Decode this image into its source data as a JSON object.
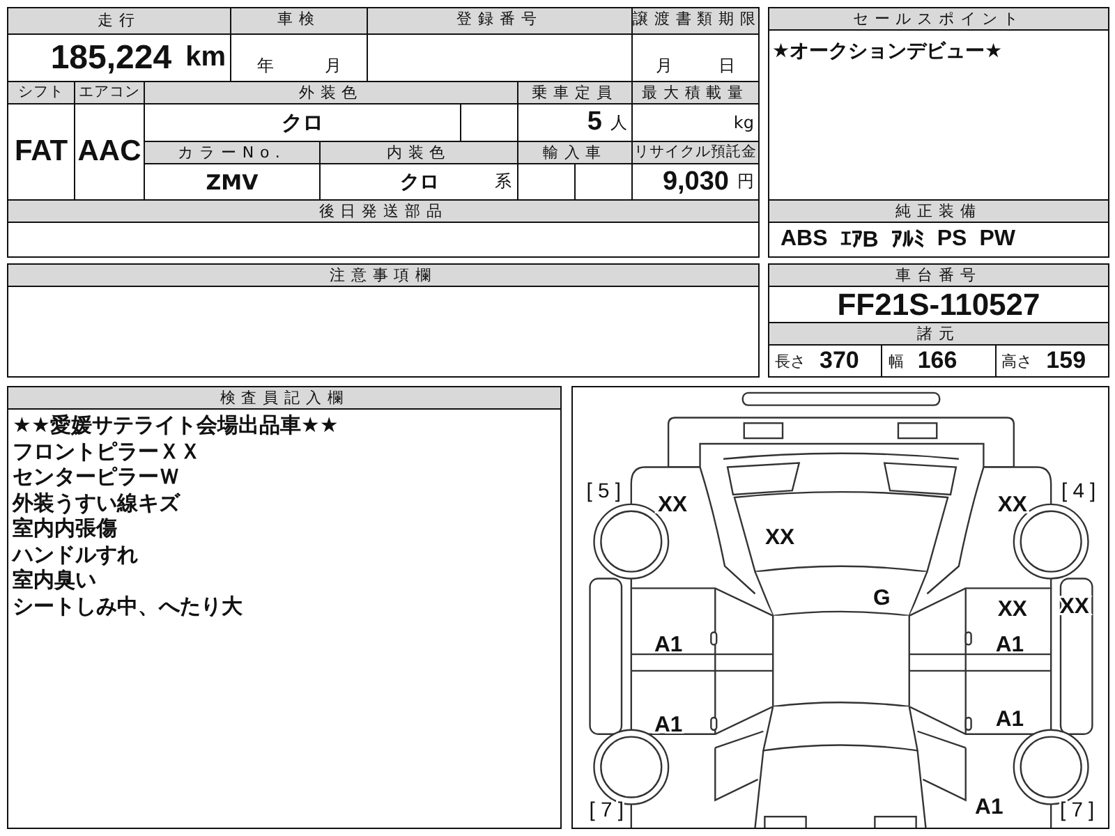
{
  "mileage": {
    "label": "走行",
    "value": "185,224",
    "unit": "km"
  },
  "inspection": {
    "label": "車検",
    "year_unit": "年",
    "month_unit": "月"
  },
  "registration": {
    "label": "登録番号"
  },
  "transfer_deadline": {
    "label": "譲渡書類期限",
    "month_unit": "月",
    "day_unit": "日"
  },
  "shift": {
    "label": "シフト",
    "value": "FAT"
  },
  "aircon": {
    "label": "エアコン",
    "value": "AAC"
  },
  "exterior_color": {
    "label": "外装色",
    "value": "クロ"
  },
  "capacity": {
    "label": "乗車定員",
    "value": "5",
    "unit": "人"
  },
  "max_load": {
    "label": "最大積載量",
    "unit": "kg"
  },
  "color_no": {
    "label": "カラーNo.",
    "value": "ZMV"
  },
  "interior_color": {
    "label": "内装色",
    "value": "クロ",
    "suffix": "系"
  },
  "import": {
    "label": "輸入車"
  },
  "recycle_fee": {
    "label": "リサイクル預託金",
    "value": "9,030",
    "unit": "円"
  },
  "later_parts": {
    "label": "後日発送部品"
  },
  "notes": {
    "label": "注意事項欄"
  },
  "sales_point": {
    "label": "セールスポイント",
    "text": "★オークションデビュー★"
  },
  "equipment": {
    "label": "純正装備",
    "items": [
      "ABS",
      "ｴｱB",
      "ｱﾙﾐ",
      "PS",
      "PW"
    ]
  },
  "chassis": {
    "label": "車台番号",
    "value": "FF21S-110527"
  },
  "dimensions": {
    "label": "諸元",
    "items": [
      {
        "label": "長さ",
        "value": "370"
      },
      {
        "label": "幅",
        "value": "166"
      },
      {
        "label": "高さ",
        "value": "159"
      }
    ]
  },
  "inspector": {
    "label": "検査員記入欄",
    "lines": [
      "★★愛媛サテライト会場出品車★★",
      "フロントピラーＸＸ",
      "センターピラーＷ",
      "外装うすい線キズ",
      "室内内張傷",
      "ハンドルすれ",
      "室内臭い",
      "シートしみ中、へたり大"
    ]
  },
  "diagram": {
    "marks": [
      {
        "kind": "panel",
        "text": "[ 5 ]"
      },
      {
        "kind": "code",
        "text": "XX"
      },
      {
        "kind": "code",
        "text": "XX"
      },
      {
        "kind": "panel",
        "text": "[ 4 ]"
      },
      {
        "kind": "code",
        "text": "XX"
      },
      {
        "kind": "code",
        "text": "G"
      },
      {
        "kind": "code",
        "text": "XX"
      },
      {
        "kind": "code",
        "text": "XX"
      },
      {
        "kind": "code",
        "text": "A1"
      },
      {
        "kind": "code",
        "text": "A1"
      },
      {
        "kind": "code",
        "text": "A1"
      },
      {
        "kind": "code",
        "text": "A1"
      },
      {
        "kind": "panel",
        "text": "[ 7 ]"
      },
      {
        "kind": "code",
        "text": "A1"
      },
      {
        "kind": "panel",
        "text": "[ 7 ]"
      }
    ]
  }
}
